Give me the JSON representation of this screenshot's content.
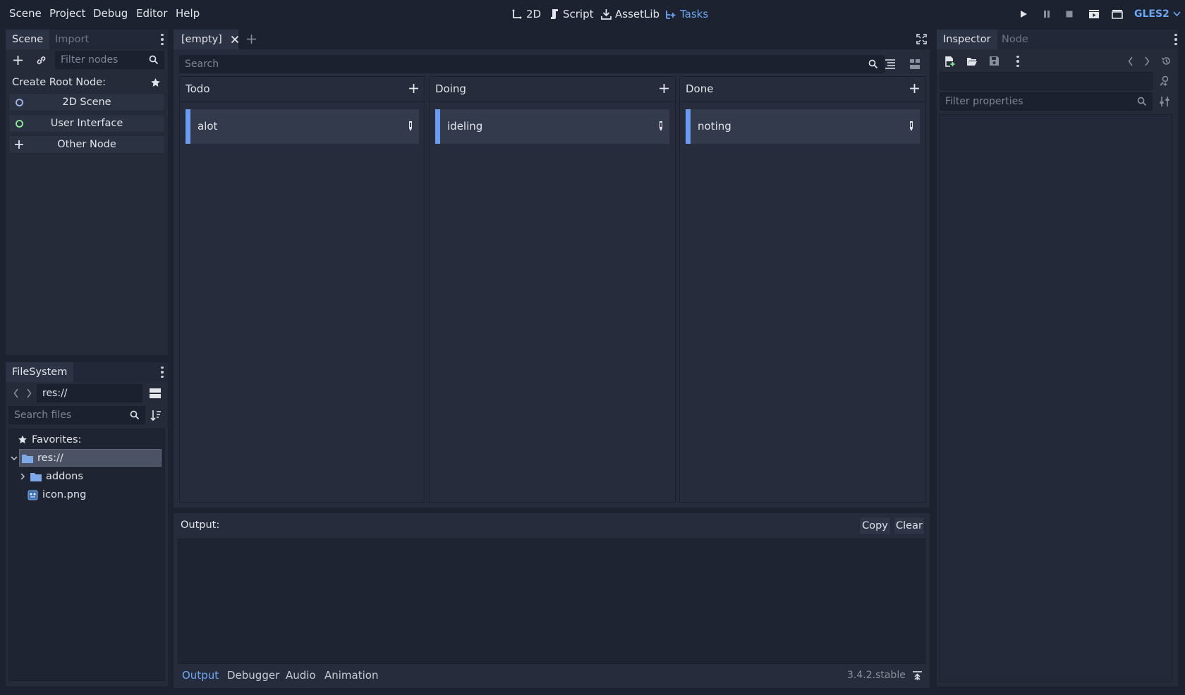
{
  "menubar": {
    "items": [
      "Scene",
      "Project",
      "Debug",
      "Editor",
      "Help"
    ],
    "workspaces": [
      "2D",
      "Script",
      "AssetLib",
      "Tasks"
    ],
    "renderer": "GLES2"
  },
  "scene_dock": {
    "tabs": [
      "Scene",
      "Import"
    ],
    "filter_placeholder": "Filter nodes",
    "create_root_label": "Create Root Node:",
    "root_buttons": [
      "2D Scene",
      "User Interface",
      "Other Node"
    ]
  },
  "filesystem_dock": {
    "tab": "FileSystem",
    "path": "res://",
    "search_placeholder": "Search files",
    "favorites_label": "Favorites:",
    "tree": [
      "res://",
      "addons",
      "icon.png"
    ]
  },
  "editor": {
    "tab_title": "[empty]",
    "search_placeholder": "Search",
    "columns": [
      {
        "title": "Todo",
        "cards": [
          "alot"
        ]
      },
      {
        "title": "Doing",
        "cards": [
          "ideling"
        ]
      },
      {
        "title": "Done",
        "cards": [
          "noting"
        ]
      }
    ]
  },
  "output": {
    "label": "Output:",
    "copy": "Copy",
    "clear": "Clear",
    "bottom_tabs": [
      "Output",
      "Debugger",
      "Audio",
      "Animation"
    ],
    "version": "3.4.2.stable"
  },
  "inspector": {
    "tabs": [
      "Inspector",
      "Node"
    ],
    "filter_placeholder": "Filter properties"
  },
  "colors": {
    "accent": "#6ca7f4",
    "card_bar": "#6a9bf0",
    "background": "#1d2230",
    "panel": "#252b39"
  }
}
